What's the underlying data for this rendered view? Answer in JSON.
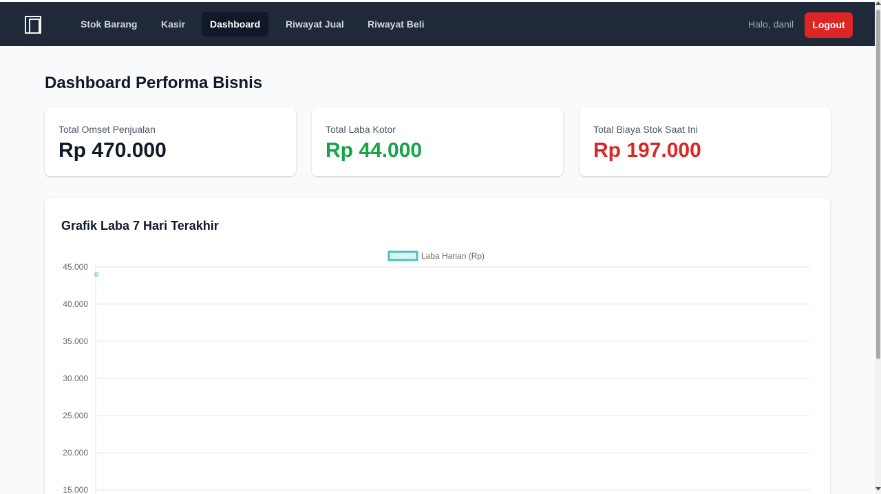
{
  "navbar": {
    "logo_icon": "building-icon",
    "links": [
      {
        "label": "Stok Barang",
        "active": false
      },
      {
        "label": "Kasir",
        "active": false
      },
      {
        "label": "Dashboard",
        "active": true
      },
      {
        "label": "Riwayat Jual",
        "active": false
      },
      {
        "label": "Riwayat Beli",
        "active": false
      }
    ],
    "greeting": "Halo, danil",
    "logout_label": "Logout",
    "colors": {
      "background": "#1f2937",
      "active_link": "#111827",
      "logout": "#dc2626"
    }
  },
  "page": {
    "title": "Dashboard Performa Bisnis"
  },
  "stats": [
    {
      "label": "Total Omset Penjualan",
      "value": "Rp 470.000",
      "color": "#111827"
    },
    {
      "label": "Total Laba Kotor",
      "value": "Rp 44.000",
      "color": "#16a34a"
    },
    {
      "label": "Total Biaya Stok Saat Ini",
      "value": "Rp 197.000",
      "color": "#dc2626"
    }
  ],
  "chart_section": {
    "title": "Grafik Laba 7 Hari Terakhir"
  },
  "chart_data": {
    "type": "line",
    "title": "Grafik Laba 7 Hari Terakhir",
    "series": [
      {
        "name": "Laba Harian (Rp)",
        "values": [
          44000
        ],
        "color": "#4bc0c0"
      }
    ],
    "y_ticks": [
      "45.000",
      "40.000",
      "35.000",
      "30.000",
      "25.000",
      "20.000",
      "15.000"
    ],
    "y_tick_values": [
      45000,
      40000,
      35000,
      30000,
      25000,
      20000,
      15000
    ],
    "ylim": [
      15000,
      45000
    ],
    "legend_position": "top",
    "grid": true
  }
}
